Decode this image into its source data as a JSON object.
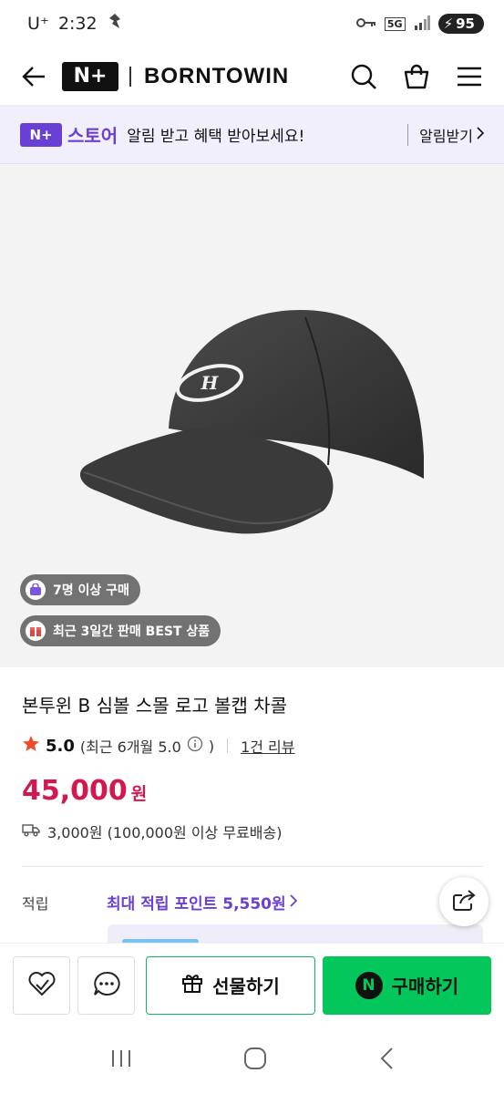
{
  "status_bar": {
    "carrier": "U⁺",
    "time": "2:32",
    "network": "5G",
    "battery": "95"
  },
  "header": {
    "logo": "N+",
    "brand": "BORNTOWIN"
  },
  "banner": {
    "store_logo": "N+",
    "store_name": "스토어",
    "text": "알림 받고 혜택 받아보세요!",
    "button": "알림받기"
  },
  "product": {
    "badges": [
      "7명 이상 구매",
      "최근 3일간 판매 BEST 상품"
    ],
    "title": "본투윈 B 심볼 스몰 로고 볼캡 차콜",
    "rating": {
      "score": "5.0",
      "detail": "(최근 6개월 5.0",
      "reviews": "1건 리뷰"
    },
    "price": "45,000",
    "currency": "원",
    "shipping": "3,000원 (100,000원 이상 무료배송)",
    "points_label": "적립",
    "points_value": "최대 적립 포인트 5,550원"
  },
  "actions": {
    "gift": "선물하기",
    "buy": "구매하기",
    "buy_icon": "N"
  },
  "colors": {
    "accent": "#6a3fd6",
    "price": "#d3174f",
    "buy": "#03c75a"
  }
}
